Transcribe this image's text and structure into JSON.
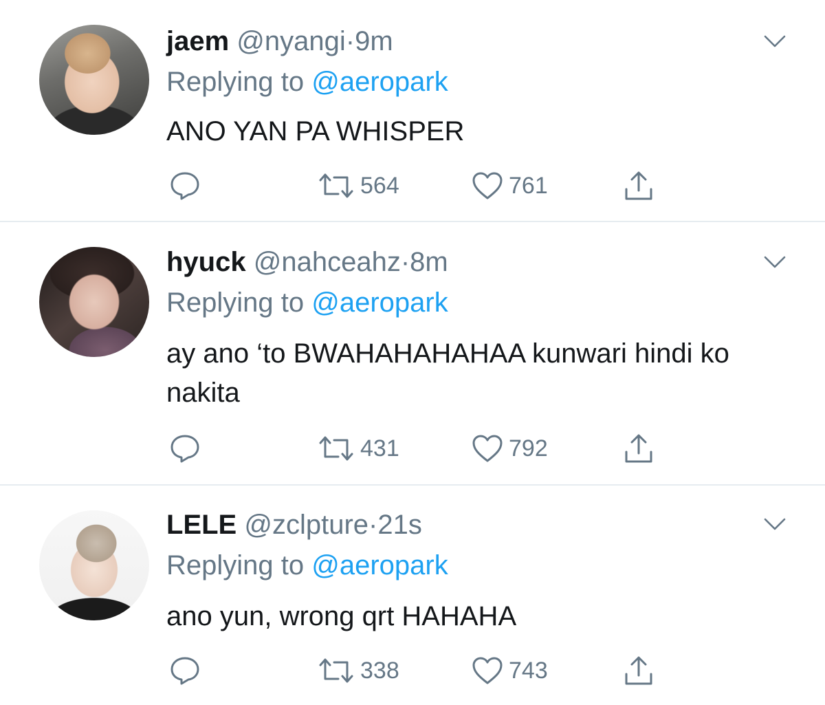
{
  "colors": {
    "text_primary": "#14171a",
    "text_secondary": "#657786",
    "link": "#1da1f2",
    "divider": "#e6ecf0"
  },
  "icons": {
    "reply": "reply-icon",
    "retweet": "retweet-icon",
    "like": "heart-icon",
    "share": "share-icon",
    "more": "chevron-down-icon"
  },
  "tweets": [
    {
      "display_name": "jaem",
      "handle": "@nyangi",
      "separator": "·",
      "time": "9m",
      "replying_prefix": "Replying to",
      "replying_to": "@aeropark",
      "text": "ANO YAN PA WHISPER",
      "retweets": "564",
      "likes": "761"
    },
    {
      "display_name": "hyuck",
      "handle": "@nahceahz",
      "separator": "·",
      "time": "8m",
      "replying_prefix": "Replying to",
      "replying_to": "@aeropark",
      "text": "ay ano ‘to BWAHAHAHAHAA kunwari hindi ko nakita",
      "retweets": "431",
      "likes": "792"
    },
    {
      "display_name": "LELE",
      "handle": "@zclpture",
      "separator": "·",
      "time": "21s",
      "replying_prefix": "Replying to",
      "replying_to": "@aeropark",
      "text": "ano yun, wrong qrt HAHAHA",
      "retweets": "338",
      "likes": "743"
    }
  ]
}
